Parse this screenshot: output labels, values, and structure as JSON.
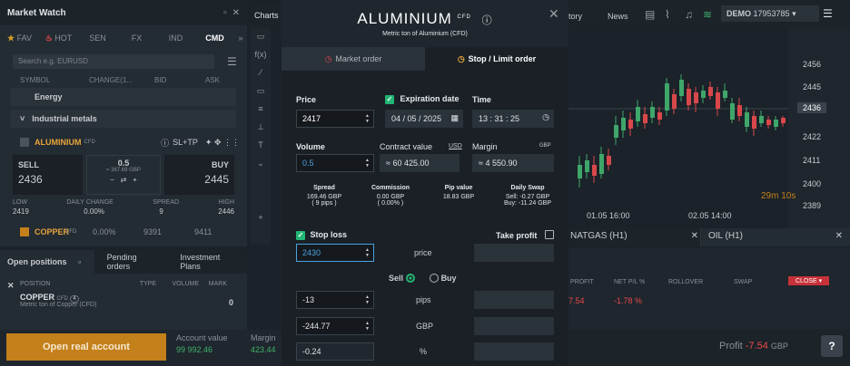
{
  "market_watch": {
    "title": "Market Watch",
    "tabs": [
      "FAV",
      "HOT",
      "SEN",
      "FX",
      "IND",
      "CMD"
    ],
    "search_placeholder": "Search e.g. EURUSD",
    "columns": [
      "SYMBOL",
      "CHANGE(1...",
      "BID",
      "ASK"
    ],
    "groups": [
      "Energy",
      "Industrial metals"
    ],
    "selected": {
      "name": "ALUMINIUM",
      "type": "CFD",
      "sltp": "SL+TP",
      "sell_label": "SELL",
      "sell": "2436",
      "spread_val": "0.5",
      "spread_sub": "≈ 367.69 GBP",
      "buy_label": "BUY",
      "buy": "2445",
      "stats_labels": [
        "LOW",
        "DAILY CHANGE",
        "SPREAD",
        "HIGH"
      ],
      "stats_values": [
        "2419",
        "0.00%",
        "9",
        "2446"
      ]
    },
    "other": {
      "name": "COPPER",
      "type": "CFD",
      "change": "0.00%",
      "bid": "9391",
      "ask": "9411"
    }
  },
  "positions": {
    "tabs": [
      "Open positions",
      "Pending orders",
      "Investment Plans"
    ],
    "columns": [
      "POSITION",
      "TYPE",
      "VOLUME",
      "MARK"
    ],
    "row": {
      "name": "COPPER",
      "type": "CFD",
      "count": "4",
      "desc": "Metric ton of Copper (CFD)",
      "volume": "0"
    }
  },
  "account": {
    "cta": "Open real account",
    "value_label": "Account value",
    "value": "99 992.46",
    "margin_label": "Margin",
    "margin": "423.44"
  },
  "charts": {
    "title": "Charts",
    "chart_tabs": [
      "NATGAS (H1)",
      "OIL (H1)"
    ],
    "timer": "29m 10s",
    "x_labels": [
      "01.05 16:00",
      "02.05 14:00"
    ],
    "y_labels": [
      "2456",
      "2445",
      "2436",
      "2422",
      "2411",
      "2400",
      "2389"
    ]
  },
  "topbar": {
    "history": "tory",
    "news": "News",
    "demo": "DEMO",
    "account_id": "17953785"
  },
  "right_table": {
    "columns": [
      "PROFIT",
      "NET P/L %",
      "ROLLOVER",
      "SWAP"
    ],
    "profit": "7.54",
    "net": "-1.78 %",
    "close": "CLOSE"
  },
  "footer": {
    "profit_label": "Profit",
    "profit": "-7.54",
    "currency": "GBP"
  },
  "modal": {
    "title": "ALUMINIUM",
    "type": "CFD",
    "subtitle": "Metric ton of Aluminium (CFD)",
    "tabs": [
      "Market order",
      "Stop / Limit order"
    ],
    "price_label": "Price",
    "price": "2417",
    "exp_label": "Expiration date",
    "date": "04 / 05 / 2025",
    "time_label": "Time",
    "time": "13 : 31 : 25",
    "volume_label": "Volume",
    "volume": "0.5",
    "cv_label": "Contract value",
    "cv_cur": "USD",
    "cv": "≈ 60 425.00",
    "margin_label": "Margin",
    "margin_cur": "GBP",
    "margin": "≈ 4 550.90",
    "info": [
      {
        "l": "Spread",
        "v": "169.46 GBP",
        "v2": "( 9 pips )"
      },
      {
        "l": "Commission",
        "v": "0.00 GBP",
        "v2": "( 0.00% )"
      },
      {
        "l": "Pip value",
        "v": "18.83 GBP",
        "v2": ""
      },
      {
        "l": "Daily Swap",
        "v": "Sell: -0.27 GBP",
        "v2": "Buy: -11.24 GBP"
      }
    ],
    "sl_label": "Stop loss",
    "tp_label": "Take profit",
    "sl_price": "2430",
    "price_word": "price",
    "sell": "Sell",
    "buy": "Buy",
    "pips": "-13",
    "pips_word": "pips",
    "gbp": "-244.77",
    "gbp_word": "GBP",
    "pct": "-0.24",
    "pct_word": "%"
  }
}
